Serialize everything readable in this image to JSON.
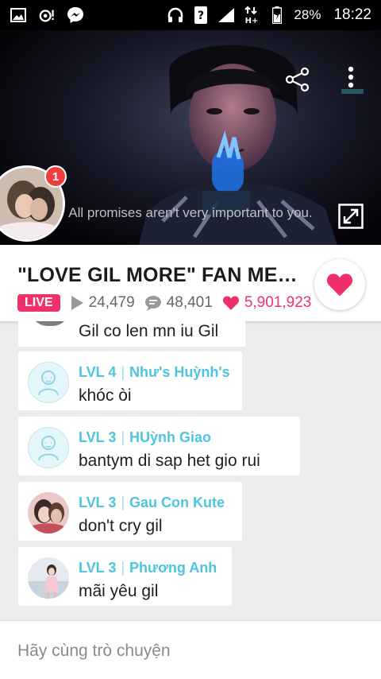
{
  "status_bar": {
    "battery": "28%",
    "time": "18:22"
  },
  "video": {
    "subtitle": "All promises aren't very important to you.",
    "notification_count": "1"
  },
  "stream": {
    "title": "\"LOVE GIL MORE\" FAN MEETI...",
    "live_label": "LIVE",
    "views": "24,479",
    "comments": "48,401",
    "likes": "5,901,923"
  },
  "chat": {
    "messages": [
      {
        "level": "",
        "name": "",
        "text": "Gil co len mn iu Gil"
      },
      {
        "level": "LVL 4",
        "name": "Như's Huỳnh's",
        "text": "khóc òi"
      },
      {
        "level": "LVL 3",
        "name": "HUỳnh Giao",
        "text": " bantym di sap het gio rui"
      },
      {
        "level": "LVL 3",
        "name": "Gau Con Kute",
        "text": "don't cry gil"
      },
      {
        "level": "LVL 3",
        "name": "Phương Anh",
        "text": "mãi yêu gil"
      }
    ]
  },
  "input": {
    "placeholder": "Hãy cùng trò chuyện"
  },
  "colors": {
    "accent": "#f0306a",
    "username": "#4ec4de"
  }
}
